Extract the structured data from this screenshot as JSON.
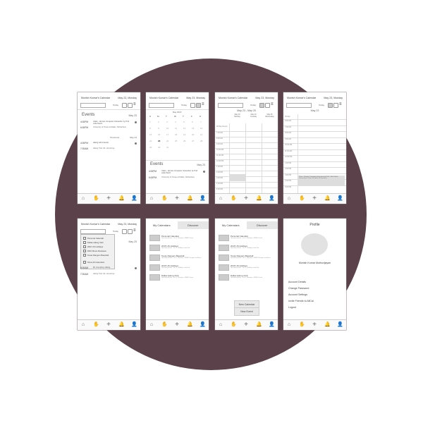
{
  "common": {
    "app_title": "Monish Kumar's Calendar",
    "date_short": "May 23, Monday",
    "today_label": "Today",
    "events_title": "Events",
    "date_label": "May 23"
  },
  "screen1": {
    "events": [
      {
        "time": "4:00PM",
        "desc": "Class - Human Computer Interaction by Prof. Julie Kientz",
        "loc": "University of Texas at Dallas, Richardson"
      },
      {
        "time": "6:00PM",
        "desc": "",
        "loc": ""
      }
    ],
    "tomorrow_label": "Tomorrow",
    "tomorrow_date": "May 24",
    "events2": [
      {
        "time": "4:00PM",
        "desc": "Hiking with Friends",
        "loc": ""
      },
      {
        "time": "7:00AM",
        "desc": "",
        "loc": "Hiking Trail, Mt. Humphrey"
      }
    ]
  },
  "screen2": {
    "month_label": "May 2016",
    "weekdays": [
      "S",
      "M",
      "T",
      "W",
      "T",
      "F",
      "S"
    ],
    "events": [
      {
        "time": "4:00PM",
        "desc": "Class - Human Computer Interaction by Prof. Julie Kientz",
        "loc": ""
      },
      {
        "time": "6:00PM",
        "desc": "",
        "loc": "University of Texas at Dallas, Richardson"
      }
    ]
  },
  "screen3": {
    "range_label": "May 23 - May 25",
    "days": [
      {
        "date": "May 23",
        "name": "Monday"
      },
      {
        "date": "May 24",
        "name": "Tuesday"
      },
      {
        "date": "May 25",
        "name": "Wednesday"
      }
    ],
    "all_day": "All Day Events",
    "times": [
      "7:00 AM",
      "8:00 AM",
      "9:00 AM",
      "10:00 AM",
      "11:00 AM",
      "12:00 PM",
      "1:00 PM",
      "2:00 PM",
      "3:00 PM",
      "4:00 PM",
      "5:00 PM"
    ]
  },
  "screen4": {
    "date_header": "May 23",
    "all_day": "All Day",
    "times": [
      "6:00 AM",
      "7:00 AM",
      "8:00 AM",
      "9:00 AM",
      "10:00 AM",
      "11:00 AM",
      "12:00 PM",
      "1:00 PM",
      "2:00 PM",
      "3:00 PM",
      "4:00 PM",
      "5:00 PM"
    ],
    "block_text": "Class - Human Computer Interaction by Prof. Julie Kientz",
    "block_loc": "University of Texas at Dallas, Richardson"
  },
  "screen5": {
    "dropdown": [
      "Personal Calendar",
      "Dallas Hiking Club",
      "2016 US Holidays",
      "2016 Movie Releases",
      "Texas Rangers Baseball",
      "Show All Calendars"
    ],
    "events": [
      {
        "time": "6:00AM",
        "desc": "Mt. Humphrey Hiking",
        "loc": ""
      },
      {
        "time": "7:00AM",
        "desc": "",
        "loc": "Hiking Trail, Mt. Humphrey"
      }
    ]
  },
  "calendars": {
    "tab_my": "My Calendars",
    "tab_discover": "Discover",
    "items": [
      {
        "name": "Personal Calendar",
        "sub": "Upcoming Event : Jun 1, Monday > SBMC Guest"
      },
      {
        "name": "2016 US Holidays",
        "sub": "Upcoming Event : Jun 1, Holidays ends first"
      },
      {
        "name": "Texas Rangers Baseball",
        "sub": "Upcoming Event : Jun 1, Monday > SBMC Rangers vs Astros"
      },
      {
        "name": "2016 US Holidays",
        "sub": "Upcoming Event : Jun 1, Holidays ends first"
      },
      {
        "name": "Dallas Hiking Club",
        "sub": "Upcoming Event : Jun 1, Monday > SBMC Guest"
      }
    ]
  },
  "screen7": {
    "popup1": "New Calendar",
    "popup2": "New Event"
  },
  "profile": {
    "title": "Profile",
    "name": "Monish Kumar Muthuvijayan",
    "items": [
      "Account Details",
      "Change Password",
      "Account Settings",
      "Invite Friends to AllCal",
      "Logout"
    ]
  },
  "tabbar_icons": [
    "home-icon",
    "hand-icon",
    "plus-icon",
    "bell-icon",
    "user-icon"
  ]
}
